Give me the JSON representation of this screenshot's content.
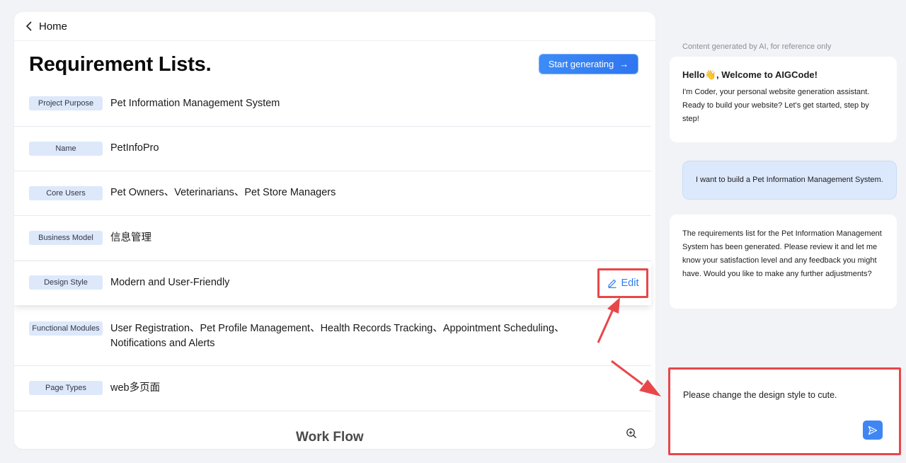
{
  "header": {
    "back_label": "Home"
  },
  "page": {
    "title": "Requirement Lists.",
    "start_button": "Start generating",
    "start_arrow": "→"
  },
  "requirements": [
    {
      "label": "Project Purpose",
      "value": "Pet Information Management System"
    },
    {
      "label": "Name",
      "value": "PetInfoPro"
    },
    {
      "label": "Core Users",
      "value": "Pet Owners、Veterinarians、Pet Store Managers"
    },
    {
      "label": "Business Model",
      "value": "信息管理"
    },
    {
      "label": "Design Style",
      "value": "Modern and User-Friendly"
    },
    {
      "label": "Functional Modules",
      "value": "User Registration、Pet Profile Management、Health Records Tracking、Appointment Scheduling、",
      "value2": "Notifications and Alerts"
    },
    {
      "label": "Page Types",
      "value": "web多页面"
    }
  ],
  "edit": {
    "label": "Edit"
  },
  "workflow": {
    "title": "Work Flow"
  },
  "chat": {
    "disclaimer": "Content generated by AI, for reference only",
    "welcome_title": "Hello👋, Welcome to AIGCode!",
    "welcome_body": "I'm Coder, your personal website generation assistant. Ready to build your website? Let's get started, step by step!",
    "user_message": "I want to build a Pet Information Management System.",
    "ai_reply": "The requirements list for the Pet Information Management System has been generated. Please review it and let me know your satisfaction level and any feedback you might have. Would you like to make any further adjustments?",
    "input_value": "Please change the design style to cute."
  },
  "colors": {
    "accent": "#2f7bf2",
    "annotation": "#e8474a",
    "tag_bg": "#dde8fb"
  },
  "icons": [
    "chevron-left-icon",
    "arrow-right-icon",
    "pencil-icon",
    "zoom-in-icon",
    "send-icon"
  ]
}
